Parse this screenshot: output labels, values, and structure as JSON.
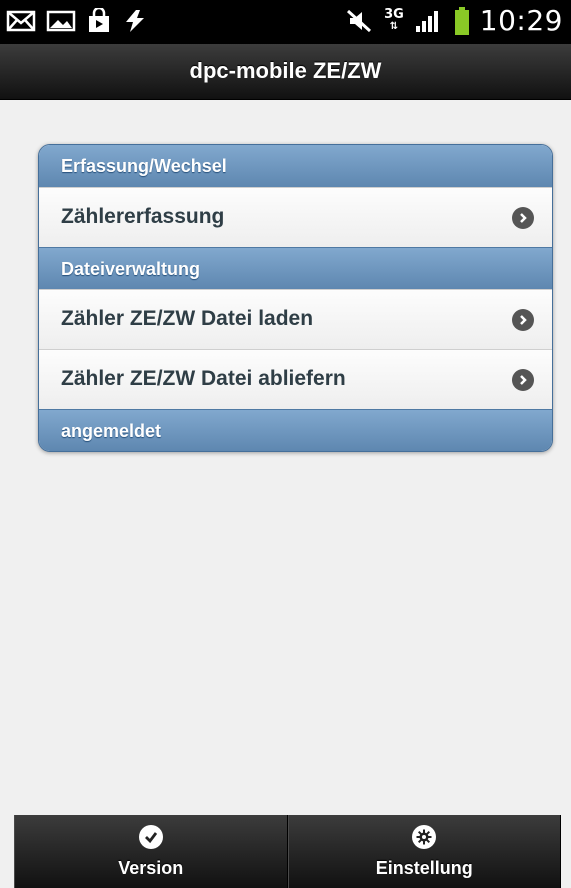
{
  "status_bar": {
    "time": "10:29",
    "network_type": "3G",
    "network_arrows": "⇅",
    "battery_color": "#8ac926",
    "icons": [
      "email-icon",
      "image-icon",
      "shopping-bag-icon",
      "usb-debug-icon",
      "mute-icon",
      "signal-icon",
      "battery-icon"
    ]
  },
  "header": {
    "title": "dpc-mobile ZE/ZW"
  },
  "list": {
    "divider_1": "Erfassung/Wechsel",
    "item_1": "Zählererfassung",
    "divider_2": "Dateiverwaltung",
    "item_2": "Zähler ZE/ZW Datei laden",
    "item_3": "Zähler ZE/ZW Datei abliefern",
    "divider_3": "angemeldet"
  },
  "footer": {
    "version_label": "Version",
    "version_icon": "check-icon",
    "settings_label": "Einstellung",
    "settings_icon": "gear-icon"
  },
  "colors": {
    "accent": "#5e87b0",
    "bar": "#111111",
    "background": "#f0f0f0"
  }
}
